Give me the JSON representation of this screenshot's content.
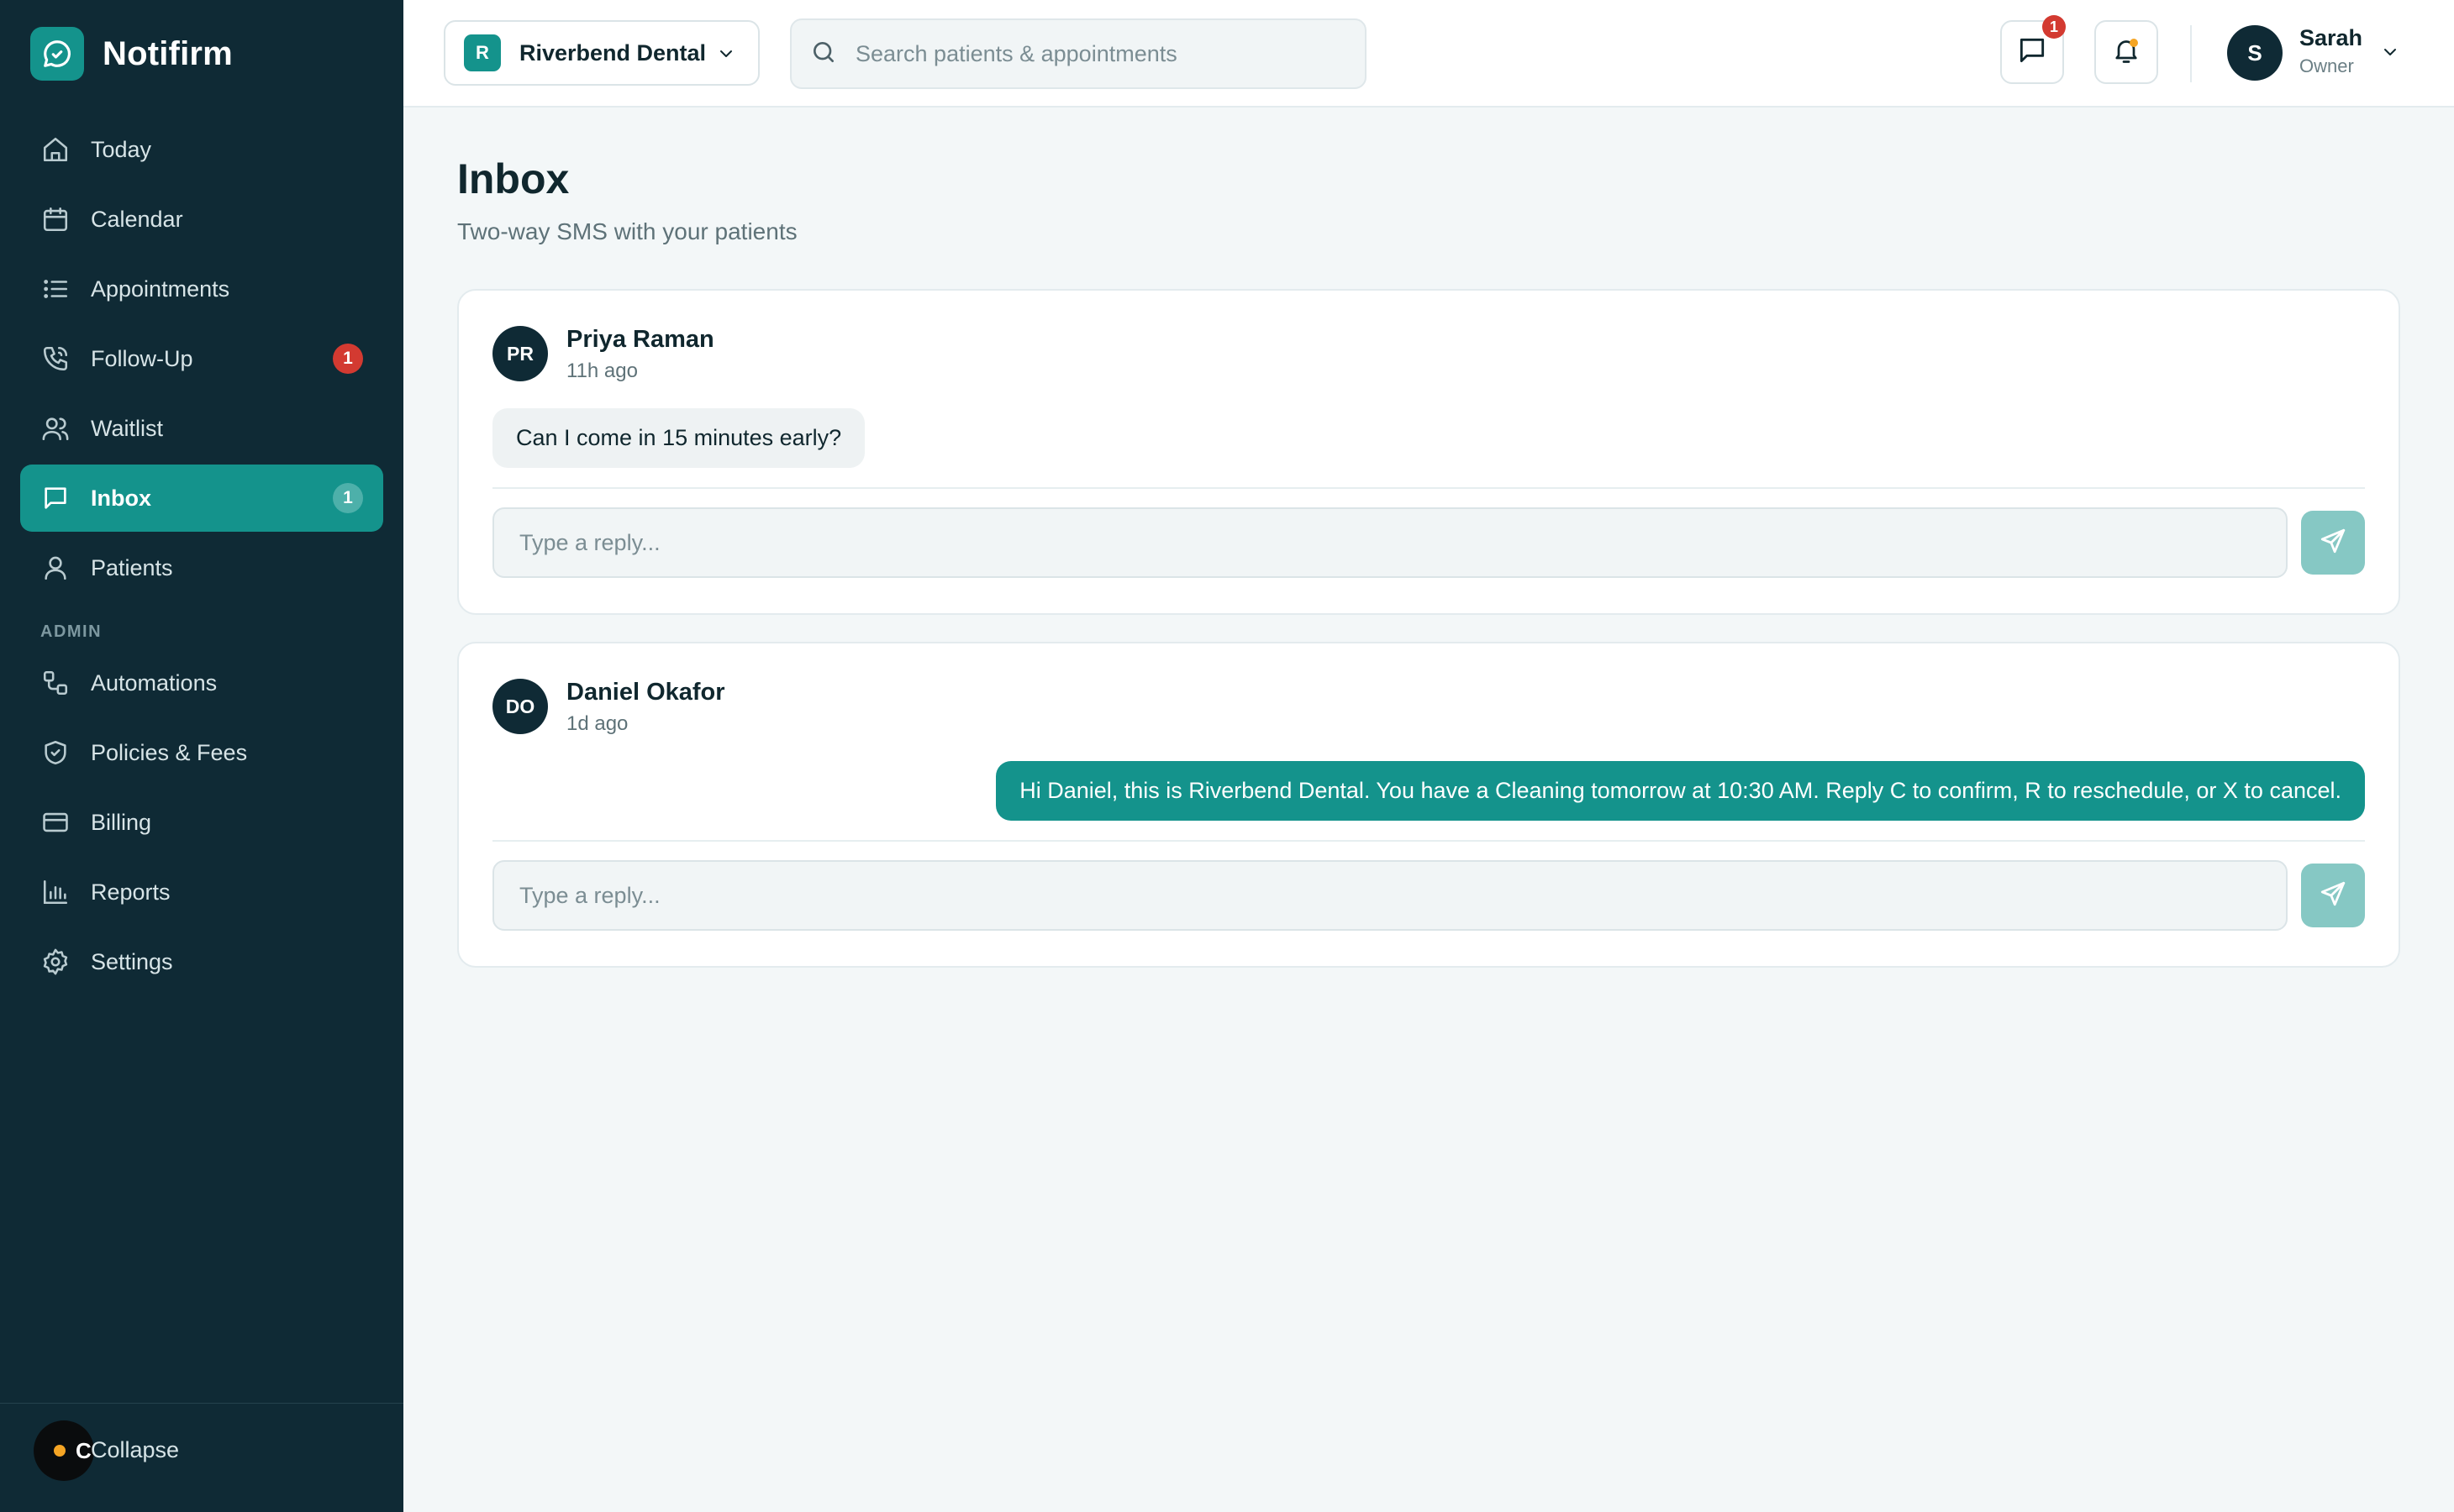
{
  "app": {
    "name": "Notifirm"
  },
  "sidebar": {
    "items": [
      {
        "label": "Today",
        "icon": "home-icon"
      },
      {
        "label": "Calendar",
        "icon": "calendar-icon"
      },
      {
        "label": "Appointments",
        "icon": "list-icon"
      },
      {
        "label": "Follow-Up",
        "icon": "phone-icon",
        "badge": "1"
      },
      {
        "label": "Waitlist",
        "icon": "users-icon"
      },
      {
        "label": "Inbox",
        "icon": "message-icon",
        "badge": "1",
        "active": true
      },
      {
        "label": "Patients",
        "icon": "user-icon"
      }
    ],
    "admin_label": "ADMIN",
    "admin_items": [
      {
        "label": "Automations",
        "icon": "workflow-icon"
      },
      {
        "label": "Policies & Fees",
        "icon": "shield-icon"
      },
      {
        "label": "Billing",
        "icon": "credit-card-icon"
      },
      {
        "label": "Reports",
        "icon": "bar-chart-icon"
      },
      {
        "label": "Settings",
        "icon": "gear-icon"
      }
    ],
    "footer": {
      "avatar_letter": "C",
      "collapse_label": "Collapse"
    }
  },
  "topbar": {
    "org": {
      "initial": "R",
      "name": "Riverbend Dental"
    },
    "search": {
      "placeholder": "Search patients & appointments"
    },
    "messages_count": "1",
    "user": {
      "initial": "S",
      "name": "Sarah",
      "role": "Owner"
    }
  },
  "page": {
    "title": "Inbox",
    "subtitle": "Two-way SMS with your patients"
  },
  "conversations": [
    {
      "initials": "PR",
      "name": "Priya Raman",
      "time": "11h ago",
      "message": "Can I come in 15 minutes early?",
      "direction": "inbound",
      "reply_placeholder": "Type a reply..."
    },
    {
      "initials": "DO",
      "name": "Daniel Okafor",
      "time": "1d ago",
      "message": "Hi Daniel, this is Riverbend Dental. You have a Cleaning tomorrow at 10:30 AM. Reply C to confirm, R to reschedule, or X to cancel.",
      "direction": "outbound",
      "reply_placeholder": "Type a reply..."
    }
  ],
  "colors": {
    "sidebar_bg": "#0f2a35",
    "accent": "#14938c",
    "badge_red": "#d33a31",
    "page_bg": "#f3f7f8"
  }
}
